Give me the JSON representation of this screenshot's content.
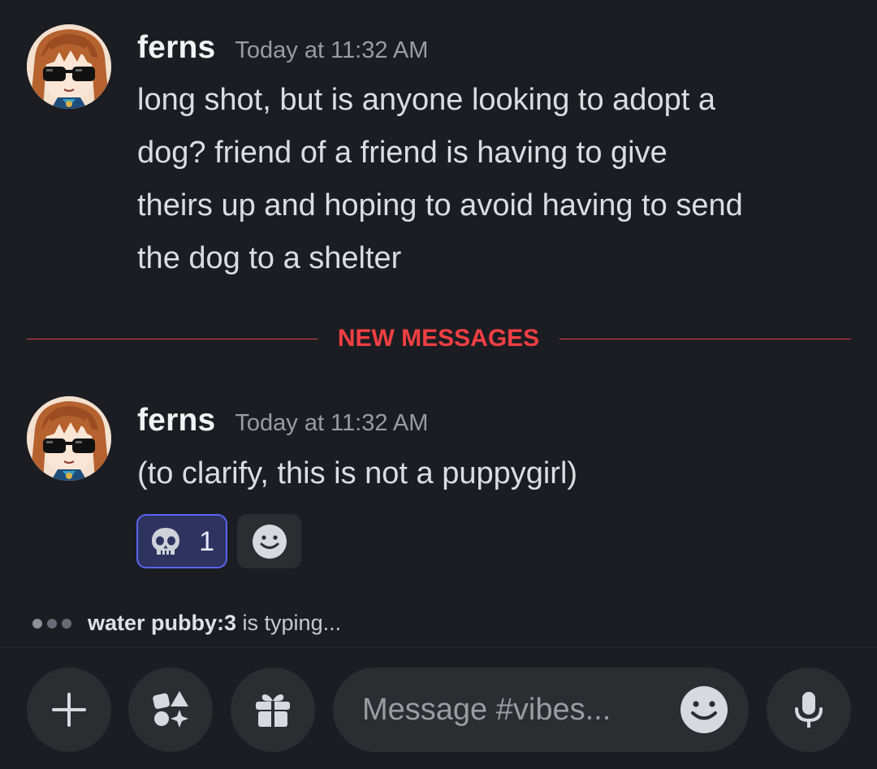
{
  "messages": [
    {
      "username": "ferns",
      "timestamp": "Today at 11:32 AM",
      "lines": [
        "long shot, but is anyone looking to adopt a",
        "dog? friend of a friend is having to give",
        "theirs up and hoping to avoid having to send",
        "the dog to a shelter"
      ]
    },
    {
      "username": "ferns",
      "timestamp": "Today at 11:32 AM",
      "text": "(to clarify, this is not a puppygirl)",
      "reactions": [
        {
          "emoji": "skull-icon",
          "count": "1",
          "active": true
        }
      ]
    }
  ],
  "divider": {
    "label": "NEW MESSAGES"
  },
  "typing": {
    "user": "water pubby:3",
    "suffix": " is typing..."
  },
  "composer": {
    "placeholder": "Message #vibes...",
    "buttons": [
      "plus-icon",
      "apps-icon",
      "gift-icon",
      "emoji-icon",
      "microphone-icon"
    ]
  },
  "colors": {
    "background": "#1c1d22",
    "new_messages_red": "#f23f43",
    "reaction_active_border": "#5865f2",
    "reaction_active_bg": "#2f3360",
    "button_bg": "#2b2d31"
  }
}
